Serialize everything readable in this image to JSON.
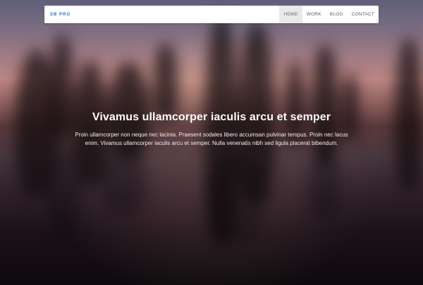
{
  "brand": {
    "label": "SB PRO",
    "color": "#2d6fc8"
  },
  "navigation": {
    "items": [
      {
        "label": "HOME",
        "active": true
      },
      {
        "label": "WORK",
        "active": false
      },
      {
        "label": "BLOG",
        "active": false
      },
      {
        "label": "CONTACT",
        "active": false
      }
    ]
  },
  "hero": {
    "title": "Vivamus ullamcorper iaculis arcu et semper",
    "description": "Proin ullamcorper non neque nec lacinia. Praesent sodales libero accumsan pulvinar tempus. Proin nec lacus enim. Vivamus ullamcorper iaculis arcu et semper. Nulla venenatis nibh sed ligula placerat bibendum."
  }
}
